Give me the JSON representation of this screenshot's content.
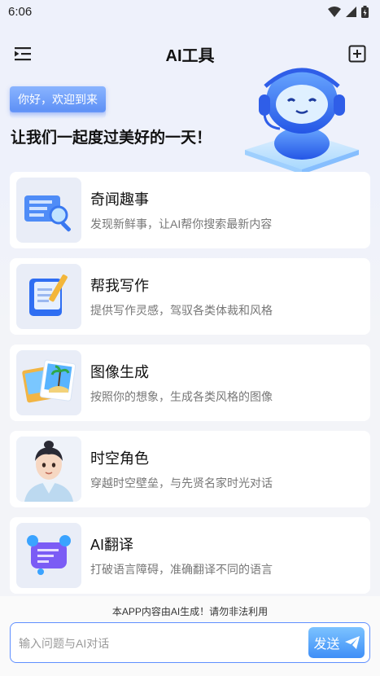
{
  "status_bar": {
    "time": "6:06"
  },
  "header": {
    "title": "AI工具"
  },
  "hero": {
    "badge": "你好，欢迎到来",
    "greeting": "让我们一起度过美好的一天！"
  },
  "cards": [
    {
      "title": "奇闻趣事",
      "desc": "发现新鲜事，让AI帮你搜索最新内容",
      "icon": "news-search-icon"
    },
    {
      "title": "帮我写作",
      "desc": "提供写作灵感，驾驭各类体裁和风格",
      "icon": "notebook-pen-icon"
    },
    {
      "title": "图像生成",
      "desc": "按照你的想象，生成各类风格的图像",
      "icon": "photo-stack-icon"
    },
    {
      "title": "时空角色",
      "desc": "穿越时空壁垒，与先贤名家时光对话",
      "icon": "character-avatar-icon"
    },
    {
      "title": "AI翻译",
      "desc": "打破语言障碍，准确翻译不同的语言",
      "icon": "translate-chat-icon"
    }
  ],
  "footer": {
    "disclaimer": "本APP内容由AI生成！请勿非法利用",
    "input_placeholder": "输入问题与AI对话",
    "send_label": "发送"
  },
  "colors": {
    "accent": "#4a90f7",
    "border": "#5f8fff"
  }
}
